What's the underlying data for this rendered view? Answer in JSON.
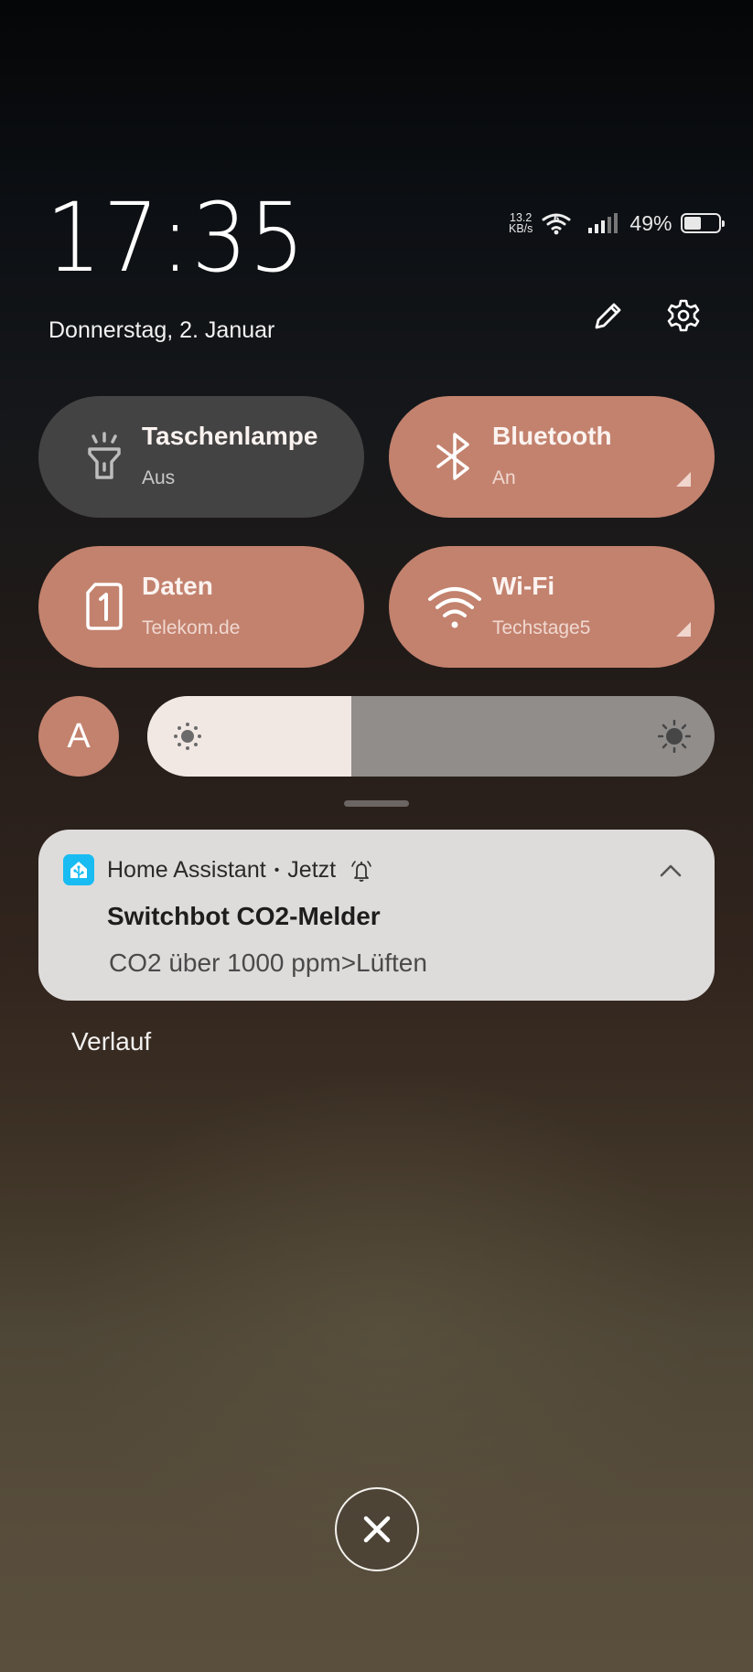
{
  "lockscreen": {
    "time": "17:35",
    "date": "Donnerstag, 2. Januar"
  },
  "status_bar": {
    "net_speed_value": "13.2",
    "net_speed_unit": "KB/s",
    "wifi_icon": "wifi-6-icon",
    "signal_icon": "cell-signal-icon",
    "battery_percent_label": "49%",
    "battery_level": 0.49
  },
  "header_actions": {
    "edit_icon": "pencil-icon",
    "settings_icon": "gear-icon"
  },
  "tiles": [
    {
      "label": "Taschenlampe",
      "sub": "Aus",
      "icon": "flashlight-icon",
      "state": "off"
    },
    {
      "label": "Bluetooth",
      "sub": "An",
      "icon": "bluetooth-icon",
      "state": "on",
      "expandable": true
    },
    {
      "label": "Daten",
      "sub": "Telekom.de",
      "icon": "sim-1-icon",
      "state": "on"
    },
    {
      "label": "Wi-Fi",
      "sub": "Techstage5",
      "icon": "wifi-icon",
      "state": "on",
      "expandable": true
    }
  ],
  "brightness": {
    "auto_label": "A",
    "level": 0.36
  },
  "notification": {
    "app_name": "Home Assistant",
    "separator": "•",
    "time": "Jetzt",
    "title": "Switchbot CO2-Melder",
    "body": "CO2 über 1000 ppm>Lüften"
  },
  "history_label": "Verlauf",
  "colors": {
    "tile_on": "#c3826e",
    "tile_off": "#444343",
    "notification_bg": "#dedcdb",
    "ha_blue": "#18bcf2"
  }
}
